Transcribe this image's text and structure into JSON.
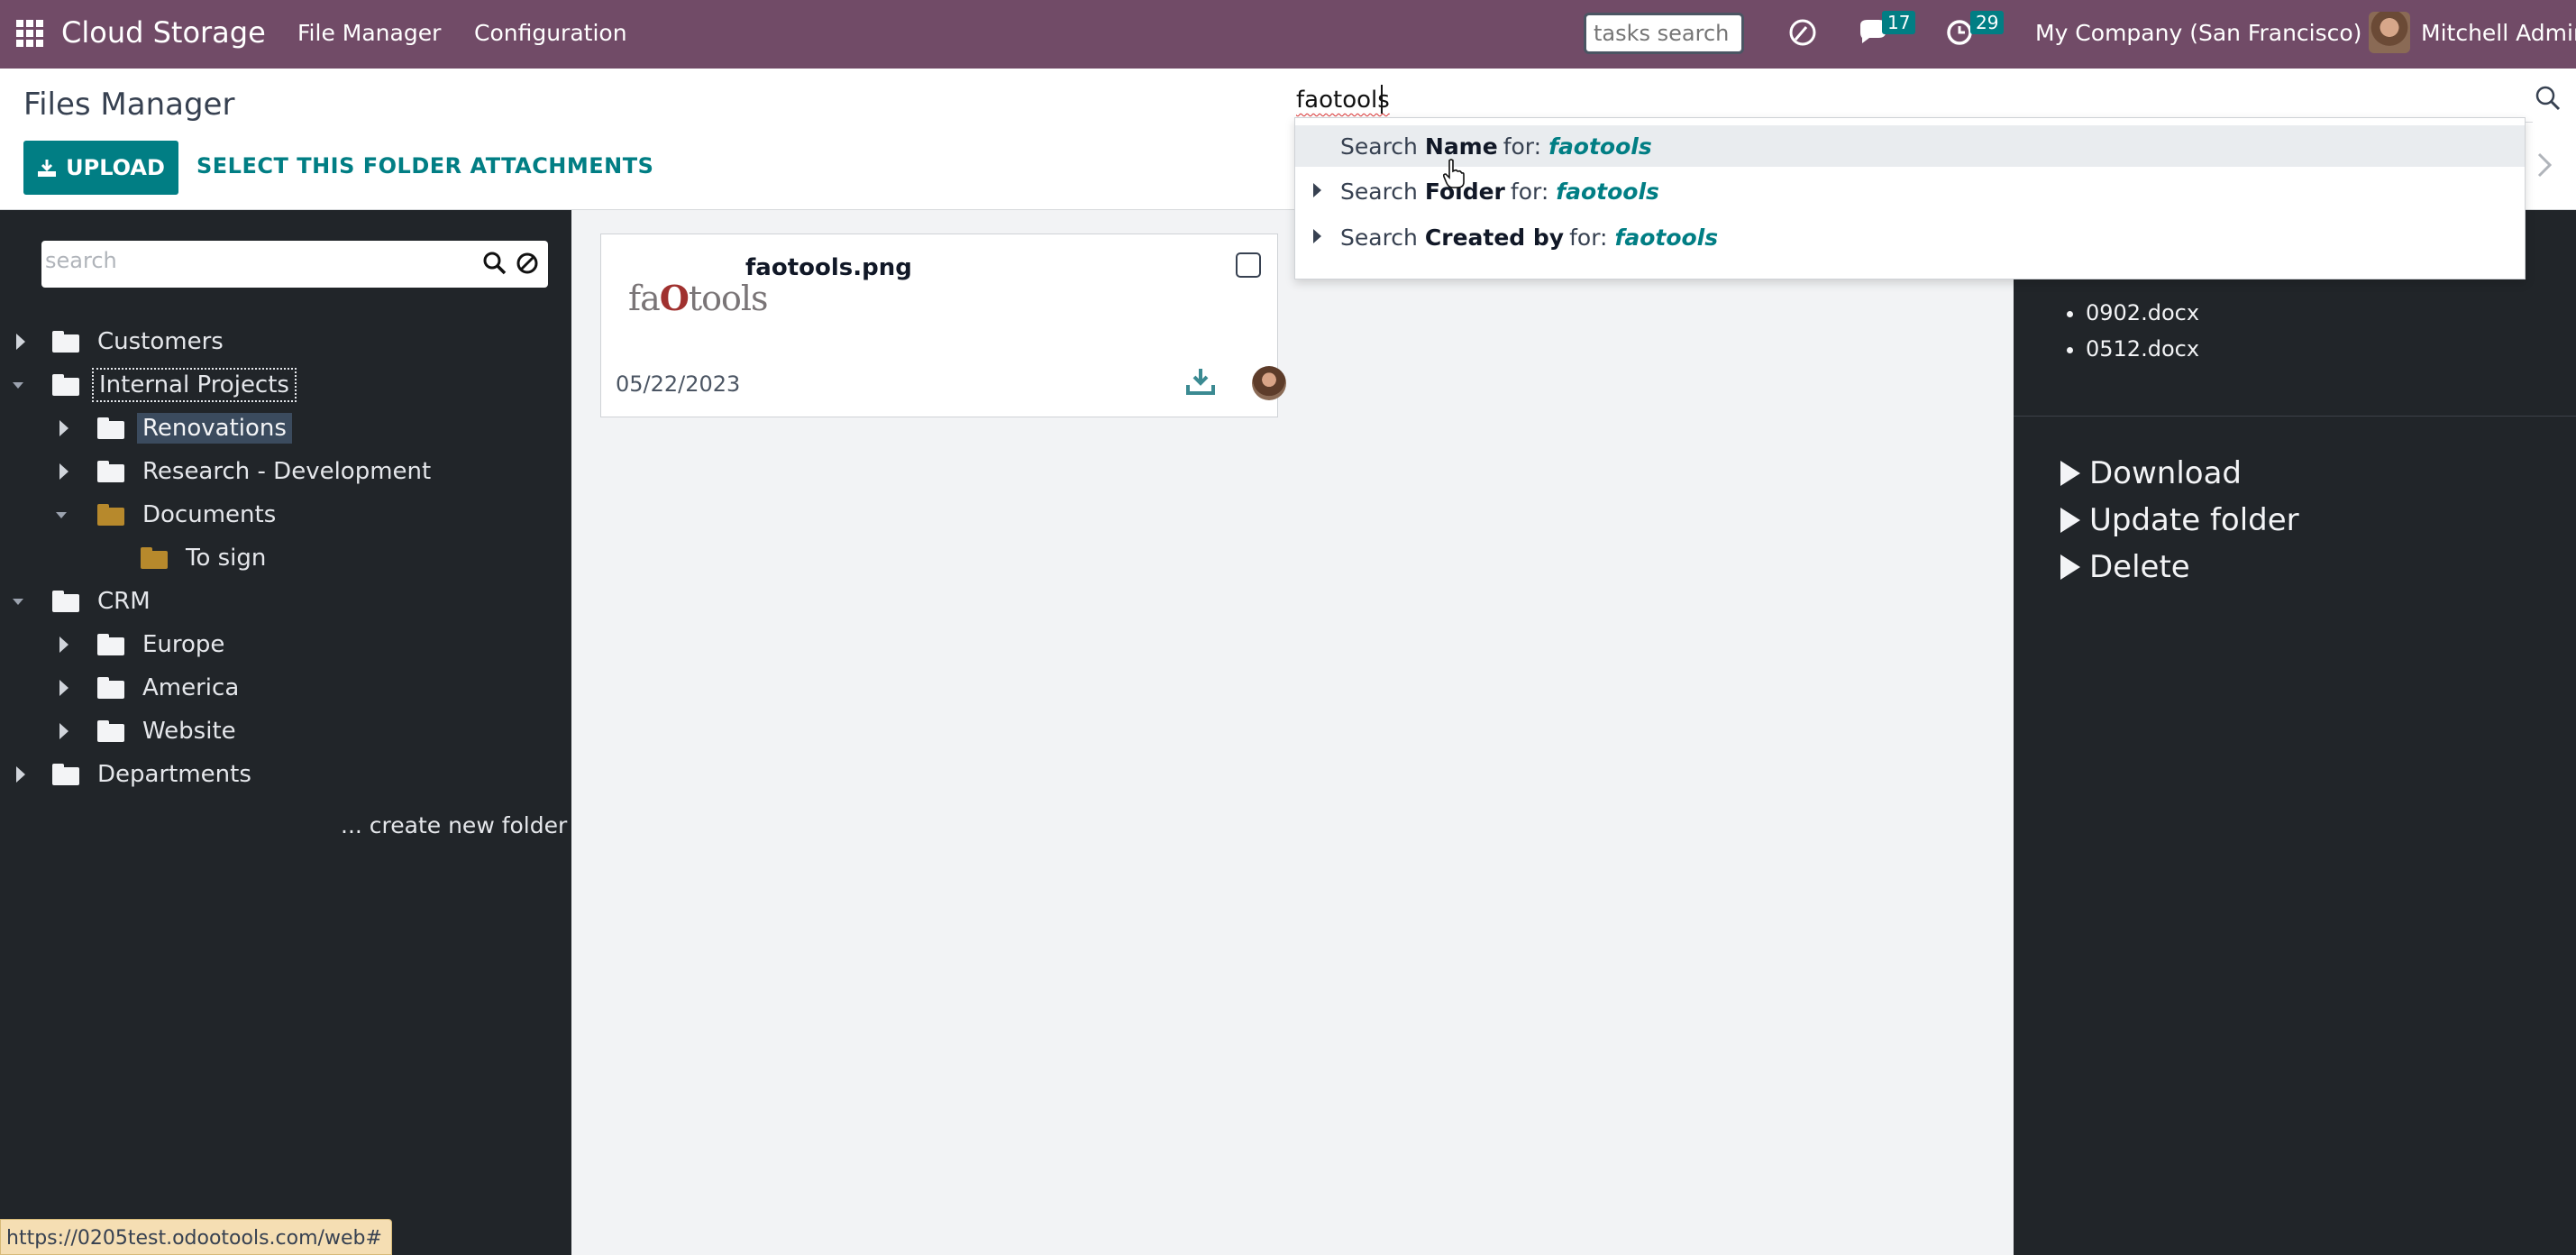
{
  "navbar": {
    "app_name": "Cloud Storage",
    "menus": [
      "File Manager",
      "Configuration"
    ],
    "tasks_search_placeholder": "tasks search",
    "messages_count": "17",
    "activities_count": "29",
    "company": "My Company (San Francisco)",
    "user": "Mitchell Admin",
    "bg_color": "#714b67"
  },
  "control_panel": {
    "title": "Files Manager",
    "upload_label": "UPLOAD",
    "select_attachments_label": "SELECT THIS FOLDER ATTACHMENTS",
    "search_value": "faotools",
    "accent_color": "#017e84"
  },
  "autocomplete": {
    "items": [
      {
        "prefix": "Search",
        "field": "Name",
        "for": "for:",
        "term": "faotools"
      },
      {
        "prefix": "Search",
        "field": "Folder",
        "for": "for:",
        "term": "faotools"
      },
      {
        "prefix": "Search",
        "field": "Created by",
        "for": "for:",
        "term": "faotools"
      }
    ]
  },
  "sidebar": {
    "search_placeholder": "search",
    "tree": [
      {
        "label": "Customers"
      },
      {
        "label": "Internal Projects"
      },
      {
        "label": "Renovations"
      },
      {
        "label": "Research - Development"
      },
      {
        "label": "Documents"
      },
      {
        "label": "To sign"
      },
      {
        "label": "CRM"
      },
      {
        "label": "Europe"
      },
      {
        "label": "America"
      },
      {
        "label": "Website"
      },
      {
        "label": "Departments"
      }
    ],
    "create_folder_label": "... create new folder"
  },
  "main": {
    "cards": [
      {
        "name": "faotools.png",
        "date": "05/22/2023",
        "thumb_text_a": "fa",
        "thumb_text_o": "O",
        "thumb_text_b": "tools"
      }
    ]
  },
  "right_panel": {
    "files": [
      "0902.docx",
      "0512.docx"
    ],
    "actions": [
      "Download",
      "Update folder",
      "Delete"
    ]
  },
  "status_bar": {
    "url": "https://0205test.odootools.com/web#"
  }
}
